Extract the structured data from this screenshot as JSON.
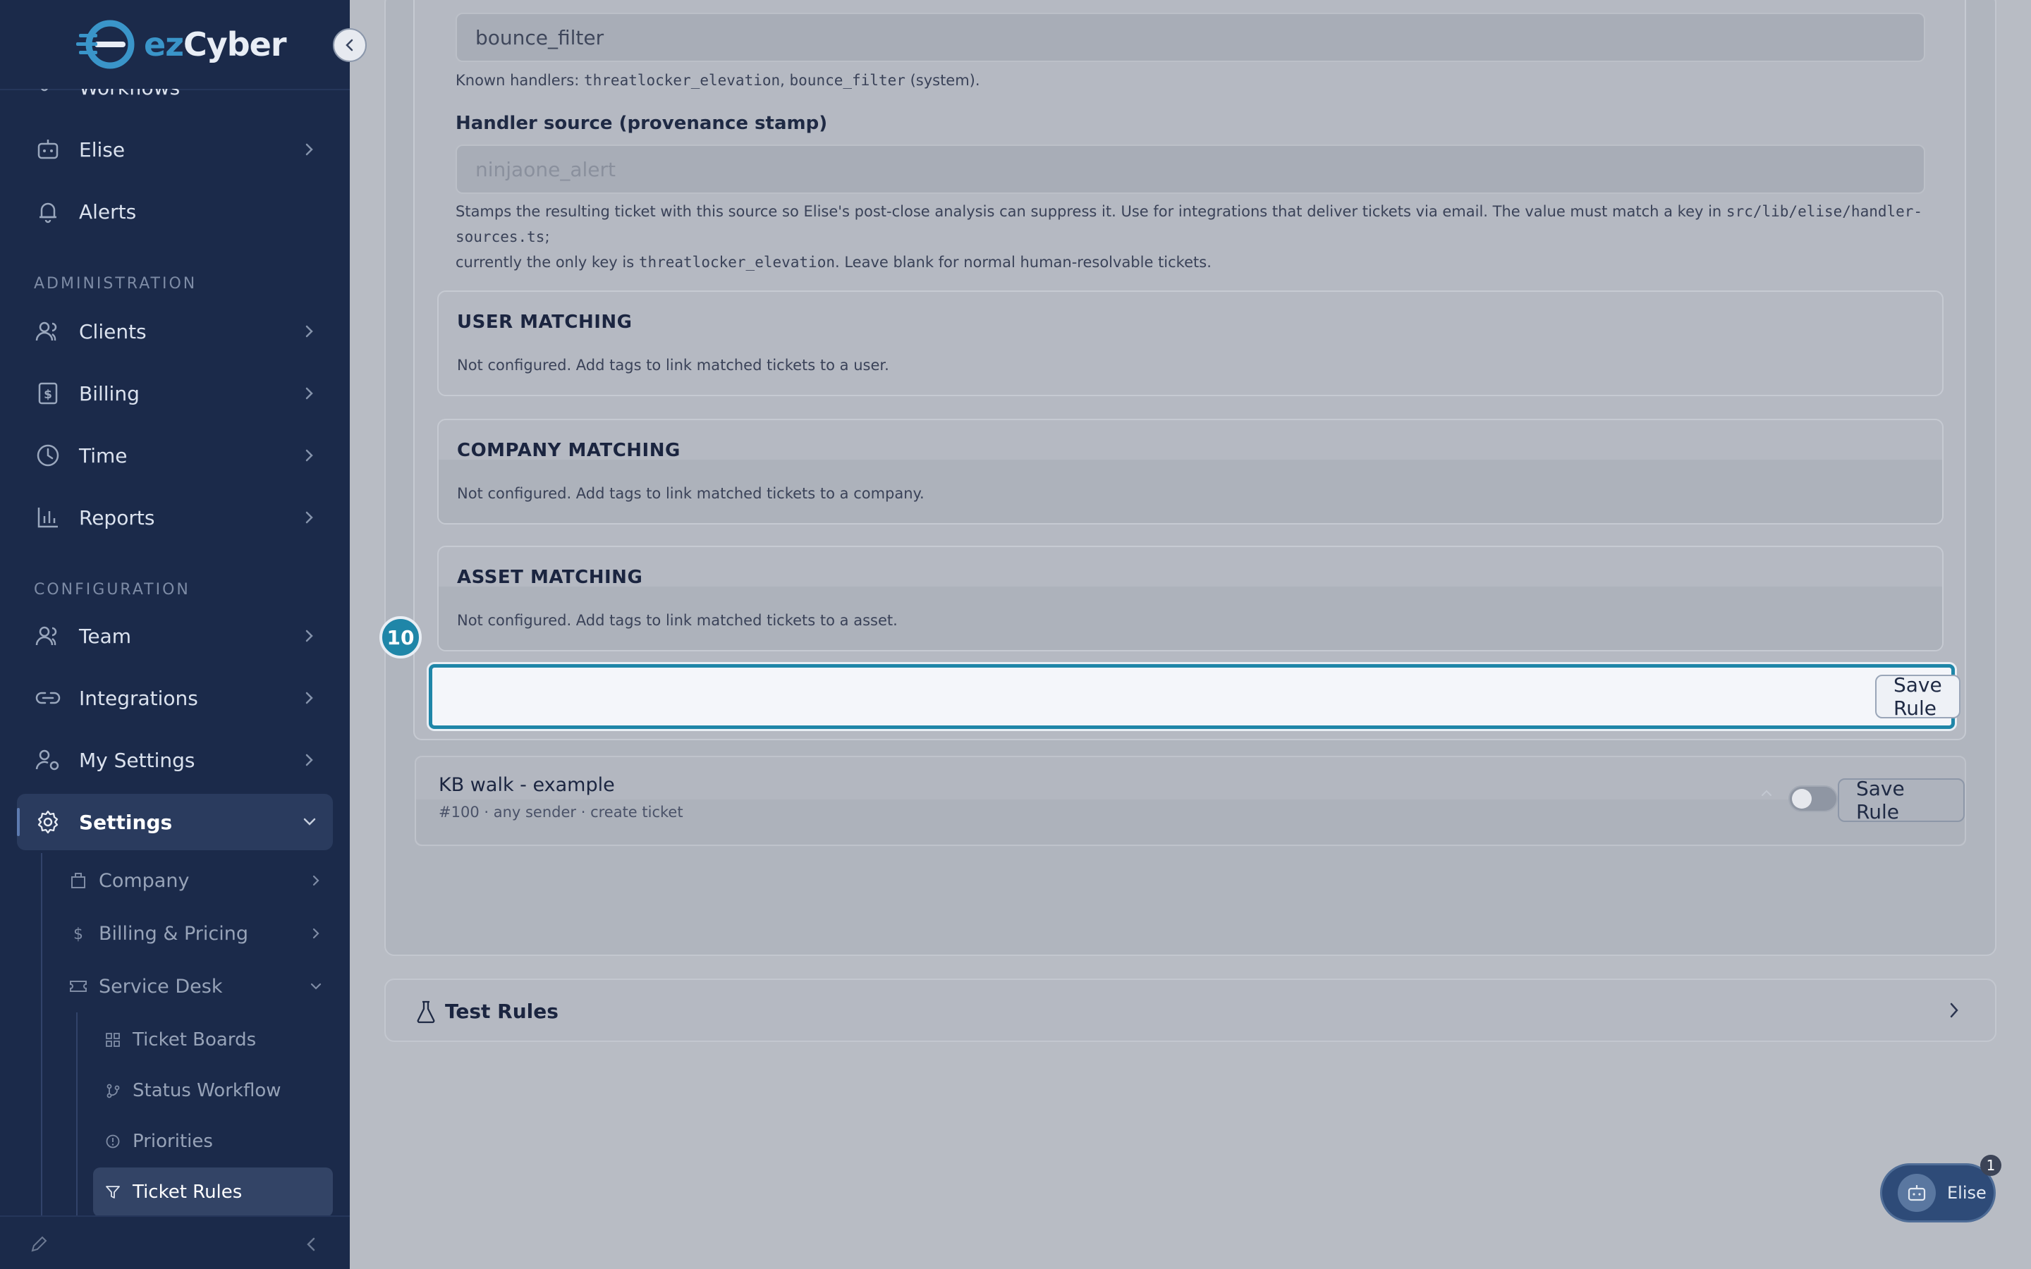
{
  "brand": {
    "ez": "ez",
    "cyber": "Cyber"
  },
  "sidebar": {
    "items_top": [
      {
        "label": "Workflows"
      },
      {
        "label": "Elise"
      },
      {
        "label": "Alerts"
      }
    ],
    "admin_label": "ADMINISTRATION",
    "admin_items": [
      {
        "label": "Clients"
      },
      {
        "label": "Billing"
      },
      {
        "label": "Time"
      },
      {
        "label": "Reports"
      }
    ],
    "config_label": "CONFIGURATION",
    "config_items": [
      {
        "label": "Team"
      },
      {
        "label": "Integrations"
      },
      {
        "label": "My Settings"
      },
      {
        "label": "Settings"
      }
    ],
    "settings_sub": [
      {
        "label": "Company"
      },
      {
        "label": "Billing & Pricing"
      },
      {
        "label": "Service Desk"
      }
    ],
    "service_desk_sub": [
      {
        "label": "Ticket Boards"
      },
      {
        "label": "Status Workflow"
      },
      {
        "label": "Priorities"
      },
      {
        "label": "Ticket Rules"
      }
    ]
  },
  "rule_form": {
    "handler_value": "bounce_filter",
    "handler_help_prefix": "Known handlers: ",
    "handler_code_1": "threatlocker_elevation",
    "handler_sep": ", ",
    "handler_code_2": "bounce_filter",
    "handler_help_suffix": " (system).",
    "source_label": "Handler source (provenance stamp)",
    "source_placeholder": "ninjaone_alert",
    "source_help_1": "Stamps the resulting ticket with this source so Elise's post-close analysis can suppress it. Use for integrations that deliver tickets via email. The value must match a key in ",
    "source_help_code_1": "src/lib/elise/handler-sources.ts",
    "source_help_2": ";",
    "source_help_3": "currently the only key is ",
    "source_help_code_2": "threatlocker_elevation",
    "source_help_4": ". Leave blank for normal human-resolvable tickets.",
    "user_matching": {
      "title": "USER MATCHING",
      "message": "Not configured. Add tags to link matched tickets to a user."
    },
    "company_matching": {
      "title": "COMPANY MATCHING",
      "message": "Not configured. Add tags to link matched tickets to a company."
    },
    "asset_matching": {
      "title": "ASSET MATCHING",
      "message": "Not configured. Add tags to link matched tickets to a asset."
    },
    "save_label": "Save Rule",
    "step_number": "10"
  },
  "rules_list": [
    {
      "title": "KB walk - example",
      "subtitle": "#100 · any sender · create ticket",
      "enabled": false,
      "save_label": "Save Rule"
    }
  ],
  "test_rules": {
    "label": "Test Rules"
  },
  "elise_fab": {
    "label": "Elise",
    "badge": "1"
  },
  "colors": {
    "accent": "#1f86a8",
    "sidebar_bg": "#1b2a4a",
    "brand_blue": "#3a95c9"
  }
}
